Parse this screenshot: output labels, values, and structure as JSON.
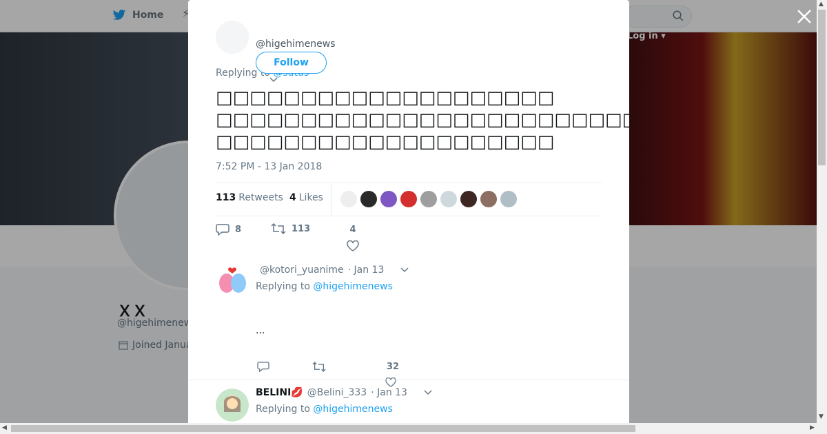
{
  "nav": {
    "home_label": "Home",
    "login_label": "Log in"
  },
  "profile": {
    "name": "ＸＸ",
    "handle": "@higehimenew",
    "joined": "Joined Janua"
  },
  "tweet": {
    "handle": "@higehimenews",
    "follow_label": "Follow",
    "replying_prefix": "Replying to ",
    "replying_to": "@sutus",
    "text_lines": [
      "□□□□□□□□□□□□□□□□□□□□",
      "□□□□□□□□□□□□□□□□□□□□□□□□□□□□□□□□□□□□□□□□□□□□□□□□□□□□□□□□□□□□",
      "□□□□□□□□□□□□□□□□□□□□"
    ],
    "time": "7:52 PM - 13 Jan 2018",
    "retweets_count": "113",
    "retweets_label": "Retweets",
    "likes_count": "4",
    "likes_label": "Likes",
    "reply_count": "8",
    "retweet_count_action": "113",
    "like_count_action": "4",
    "likers_colors": [
      "#eeeeee",
      "#2a2a2a",
      "#7e57c2",
      "#d32f2f",
      "#9e9e9e",
      "#cfd8dc",
      "#3e2723",
      "#8d6e63",
      "#b0bec5"
    ]
  },
  "replies": [
    {
      "name": "",
      "handle": "@kotori_yuanime",
      "date": "· Jan 13",
      "replying_prefix": "Replying to ",
      "replying_to": "@higehimenews",
      "body": "...",
      "like_count": "32",
      "avatar_colors": [
        "#f48fb1",
        "#90caf9"
      ]
    },
    {
      "name": "BELINI💋",
      "handle": "@Belini_333",
      "date": "· Jan 13",
      "replying_prefix": "Replying to ",
      "replying_to": "@higehimenews",
      "avatar_colors": [
        "#a5d6a7",
        "#8d6e63"
      ]
    }
  ]
}
